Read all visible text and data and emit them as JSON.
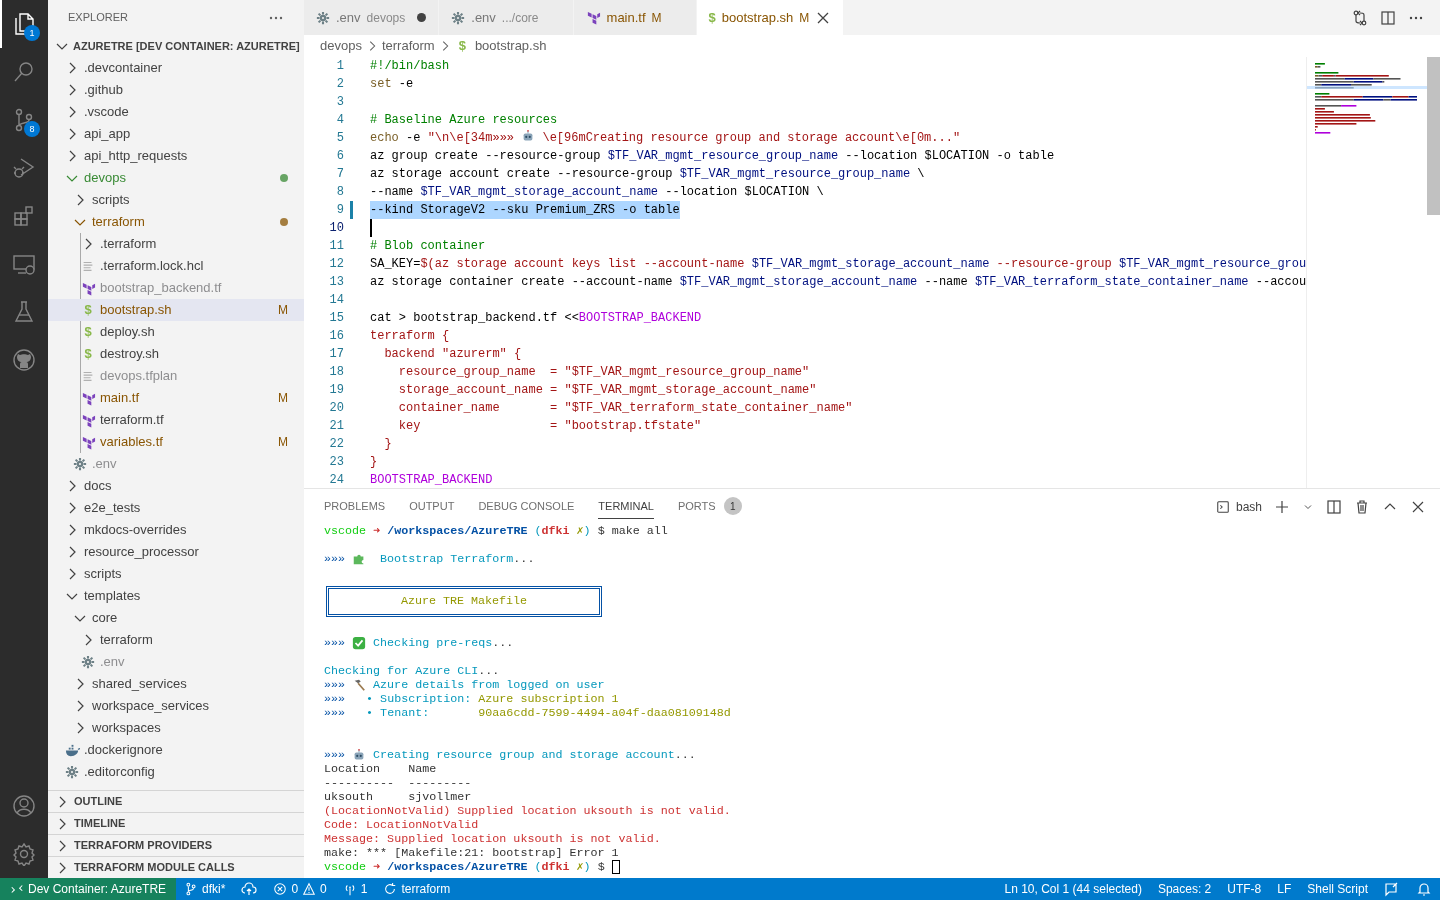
{
  "activity_bar": {
    "items": [
      {
        "kind": "files",
        "selected": true,
        "badge": "1"
      },
      {
        "kind": "search",
        "selected": false
      },
      {
        "kind": "source-control",
        "selected": false,
        "badge": "8"
      },
      {
        "kind": "run-debug",
        "selected": false
      },
      {
        "kind": "extensions",
        "selected": false
      },
      {
        "kind": "remote",
        "selected": false
      },
      {
        "kind": "testing",
        "selected": false
      },
      {
        "kind": "github",
        "selected": false
      }
    ],
    "bottom": [
      {
        "kind": "account"
      },
      {
        "kind": "settings"
      }
    ]
  },
  "sidebar": {
    "title": "EXPLORER",
    "root": {
      "label": "AZURETRE [DEV CONTAINER: AZURETRE]",
      "expanded": true
    },
    "items": [
      {
        "label": ".devcontainer",
        "kind": "folder",
        "expanded": false,
        "selected": false
      },
      {
        "label": ".github",
        "kind": "folder",
        "expanded": false,
        "selected": false
      },
      {
        "label": ".vscode",
        "kind": "folder",
        "expanded": false,
        "selected": false
      },
      {
        "label": "api_app",
        "kind": "folder",
        "expanded": false,
        "selected": false
      },
      {
        "label": "api_http_requests",
        "kind": "folder",
        "expanded": false,
        "selected": false
      },
      {
        "label": "devops",
        "kind": "folder",
        "expanded": true,
        "selected": false,
        "color": "#388a34",
        "dot": true,
        "children": [
          {
            "label": "scripts",
            "kind": "folder",
            "expanded": false,
            "selected": false
          },
          {
            "label": "terraform",
            "kind": "folder",
            "expanded": true,
            "selected": false,
            "color": "#895503",
            "dot": true,
            "children": [
              {
                "label": ".terraform",
                "kind": "folder",
                "expanded": false,
                "selected": false
              },
              {
                "label": ".terraform.lock.hcl",
                "kind": "text",
                "selected": false
              },
              {
                "label": "bootstrap_backend.tf",
                "kind": "terraform",
                "selected": false,
                "color": "#8e8e90"
              },
              {
                "label": "bootstrap.sh",
                "kind": "shell",
                "glyph": "$",
                "selected": true,
                "color": "#895503",
                "badge": "M"
              },
              {
                "label": "deploy.sh",
                "kind": "shell",
                "glyph": "$",
                "selected": false
              },
              {
                "label": "destroy.sh",
                "kind": "shell",
                "glyph": "$",
                "selected": false
              },
              {
                "label": "devops.tfplan",
                "kind": "text",
                "selected": false,
                "color": "#8e8e90"
              },
              {
                "label": "main.tf",
                "kind": "terraform",
                "selected": false,
                "color": "#895503",
                "badge": "M"
              },
              {
                "label": "terraform.tf",
                "kind": "terraform",
                "selected": false
              },
              {
                "label": "variables.tf",
                "kind": "terraform",
                "selected": false,
                "color": "#895503",
                "badge": "M"
              }
            ]
          },
          {
            "label": ".env",
            "kind": "config",
            "selected": false,
            "color": "#8e8e90"
          }
        ]
      },
      {
        "label": "docs",
        "kind": "folder",
        "expanded": false,
        "selected": false
      },
      {
        "label": "e2e_tests",
        "kind": "folder",
        "expanded": false,
        "selected": false
      },
      {
        "label": "mkdocs-overrides",
        "kind": "folder",
        "expanded": false,
        "selected": false
      },
      {
        "label": "resource_processor",
        "kind": "folder",
        "expanded": false,
        "selected": false
      },
      {
        "label": "scripts",
        "kind": "folder",
        "expanded": false,
        "selected": false
      },
      {
        "label": "templates",
        "kind": "folder",
        "expanded": true,
        "selected": false,
        "children": [
          {
            "label": "core",
            "kind": "folder",
            "expanded": true,
            "selected": false,
            "children": [
              {
                "label": "terraform",
                "kind": "folder",
                "expanded": false,
                "selected": false
              },
              {
                "label": ".env",
                "kind": "config",
                "selected": false,
                "color": "#8e8e90"
              }
            ]
          },
          {
            "label": "shared_services",
            "kind": "folder",
            "expanded": false,
            "selected": false
          },
          {
            "label": "workspace_services",
            "kind": "folder",
            "expanded": false,
            "selected": false
          },
          {
            "label": "workspaces",
            "kind": "folder",
            "expanded": false,
            "selected": false
          }
        ]
      },
      {
        "label": ".dockerignore",
        "kind": "docker",
        "selected": false
      },
      {
        "label": ".editorconfig",
        "kind": "config",
        "selected": false
      }
    ],
    "sections": [
      {
        "label": "OUTLINE",
        "expanded": false
      },
      {
        "label": "TIMELINE",
        "expanded": false
      },
      {
        "label": "TERRAFORM PROVIDERS",
        "expanded": false
      },
      {
        "label": "TERRAFORM MODULE CALLS",
        "expanded": false
      }
    ]
  },
  "editor": {
    "tabs": [
      {
        "kind": "config",
        "label": ".env",
        "description": "devops",
        "dirty": true,
        "selected": false
      },
      {
        "kind": "config",
        "label": ".env",
        "description": ".../core",
        "dirty": false,
        "selected": false
      },
      {
        "kind": "terraform",
        "label": "main.tf",
        "badge": "M",
        "color": "#895503",
        "dirty": false,
        "selected": false
      },
      {
        "kind": "shell",
        "glyph": "$",
        "label": "bootstrap.sh",
        "badge": "M",
        "color": "#895503",
        "dirty": false,
        "selected": true
      }
    ],
    "breadcrumb": [
      {
        "label": "devops"
      },
      {
        "label": "terraform"
      },
      {
        "label": "bootstrap.sh",
        "kind": "shell",
        "glyph": "$"
      }
    ],
    "lines": [
      {
        "number": "1",
        "selected": false,
        "cursor": false,
        "segments": [
          {
            "kind": "comment",
            "text": "#!/bin/bash"
          }
        ]
      },
      {
        "number": "2",
        "selected": false,
        "cursor": false,
        "segments": [
          {
            "kind": "keyword",
            "text": "set"
          },
          {
            "kind": "plain",
            "text": " -e"
          }
        ]
      },
      {
        "number": "3",
        "selected": false,
        "cursor": false
      },
      {
        "number": "4",
        "selected": false,
        "cursor": false,
        "segments": [
          {
            "kind": "comment",
            "text": "# Baseline Azure resources"
          }
        ]
      },
      {
        "number": "5",
        "selected": false,
        "cursor": false,
        "segments": [
          {
            "kind": "keyword",
            "text": "echo"
          },
          {
            "kind": "plain",
            "text": " -e "
          },
          {
            "kind": "string",
            "text": "\"\\n\\e[34m»»» "
          },
          {
            "kind": "robot"
          },
          {
            "kind": "string",
            "text": " \\e[96mCreating resource group and storage account\\e[0m...\""
          }
        ]
      },
      {
        "number": "6",
        "selected": false,
        "cursor": false,
        "segments": [
          {
            "kind": "plain",
            "text": "az group create --resource-group "
          },
          {
            "kind": "variable",
            "text": "$TF_VAR_mgmt_resource_group_name"
          },
          {
            "kind": "plain",
            "text": " --location $LOCATION -o table"
          }
        ]
      },
      {
        "number": "7",
        "selected": false,
        "cursor": false,
        "segments": [
          {
            "kind": "plain",
            "text": "az storage account create --resource-group "
          },
          {
            "kind": "variable",
            "text": "$TF_VAR_mgmt_resource_group_name"
          },
          {
            "kind": "plain",
            "text": " \\"
          }
        ]
      },
      {
        "number": "8",
        "selected": false,
        "cursor": false,
        "segments": [
          {
            "kind": "plain",
            "text": "--name "
          },
          {
            "kind": "variable",
            "text": "$TF_VAR_mgmt_storage_account_name"
          },
          {
            "kind": "plain",
            "text": " --location $LOCATION \\"
          }
        ]
      },
      {
        "number": "9",
        "selected": true,
        "cursor": false,
        "changed": true,
        "segments": [
          {
            "kind": "plain",
            "text": "--kind StorageV2 --sku Premium_ZRS -o table"
          }
        ]
      },
      {
        "number": "10",
        "selected": false,
        "cursor": true
      },
      {
        "number": "11",
        "selected": false,
        "cursor": false,
        "segments": [
          {
            "kind": "comment",
            "text": "# Blob container"
          }
        ]
      },
      {
        "number": "12",
        "selected": false,
        "cursor": false,
        "segments": [
          {
            "kind": "plain",
            "text": "SA_KEY="
          },
          {
            "kind": "string",
            "text": "$(az storage account keys list --account-name "
          },
          {
            "kind": "variable",
            "text": "$TF_VAR_mgmt_storage_account_name"
          },
          {
            "kind": "string",
            "text": " --resource-group "
          },
          {
            "kind": "variable",
            "text": "$TF_VAR_mgmt_resource_grou"
          }
        ]
      },
      {
        "number": "13",
        "selected": false,
        "cursor": false,
        "segments": [
          {
            "kind": "plain",
            "text": "az storage container create --account-name "
          },
          {
            "kind": "variable",
            "text": "$TF_VAR_mgmt_storage_account_name"
          },
          {
            "kind": "plain",
            "text": " --name "
          },
          {
            "kind": "variable",
            "text": "$TF_VAR_terraform_state_container_name"
          },
          {
            "kind": "plain",
            "text": " --accou"
          }
        ]
      },
      {
        "number": "14",
        "selected": false,
        "cursor": false
      },
      {
        "number": "15",
        "selected": false,
        "cursor": false,
        "segments": [
          {
            "kind": "plain",
            "text": "cat > bootstrap_backend.tf <<"
          },
          {
            "kind": "heredoc",
            "text": "BOOTSTRAP_BACKEND"
          }
        ]
      },
      {
        "number": "16",
        "selected": false,
        "cursor": false,
        "segments": [
          {
            "kind": "string",
            "text": "terraform {"
          }
        ]
      },
      {
        "number": "17",
        "selected": false,
        "cursor": false,
        "segments": [
          {
            "kind": "string",
            "text": "  backend \"azurerm\" {"
          }
        ]
      },
      {
        "number": "18",
        "selected": false,
        "cursor": false,
        "segments": [
          {
            "kind": "string",
            "text": "    resource_group_name  = \"$TF_VAR_mgmt_resource_group_name\""
          }
        ]
      },
      {
        "number": "19",
        "selected": false,
        "cursor": false,
        "segments": [
          {
            "kind": "string",
            "text": "    storage_account_name = \"$TF_VAR_mgmt_storage_account_name\""
          }
        ]
      },
      {
        "number": "20",
        "selected": false,
        "cursor": false,
        "segments": [
          {
            "kind": "string",
            "text": "    container_name       = \"$TF_VAR_terraform_state_container_name\""
          }
        ]
      },
      {
        "number": "21",
        "selected": false,
        "cursor": false,
        "segments": [
          {
            "kind": "string",
            "text": "    key                  = \"bootstrap.tfstate\""
          }
        ]
      },
      {
        "number": "22",
        "selected": false,
        "cursor": false,
        "segments": [
          {
            "kind": "string",
            "text": "  }"
          }
        ]
      },
      {
        "number": "23",
        "selected": false,
        "cursor": false,
        "segments": [
          {
            "kind": "string",
            "text": "}"
          }
        ]
      },
      {
        "number": "24",
        "selected": false,
        "cursor": false,
        "segments": [
          {
            "kind": "heredoc",
            "text": "BOOTSTRAP_BACKEND"
          }
        ]
      }
    ]
  },
  "panel": {
    "tabs": [
      {
        "label": "PROBLEMS",
        "selected": false
      },
      {
        "label": "OUTPUT",
        "selected": false
      },
      {
        "label": "DEBUG CONSOLE",
        "selected": false
      },
      {
        "label": "TERMINAL",
        "selected": true
      },
      {
        "label": "PORTS",
        "badge": "1",
        "selected": false
      }
    ],
    "terminal_name": "bash",
    "lines": [
      {
        "kind": "text",
        "segments": [
          {
            "kind": "user",
            "text": "vscode"
          },
          {
            "kind": "arrow",
            "text": " ➜ "
          },
          {
            "kind": "path",
            "text": "/workspaces/AzureTRE"
          },
          {
            "kind": "paren",
            "text": " ("
          },
          {
            "kind": "branch",
            "text": "dfki"
          },
          {
            "kind": "dirty",
            "text": " ✗"
          },
          {
            "kind": "paren",
            "text": ")"
          },
          {
            "kind": "plain",
            "text": " $ make all"
          }
        ]
      },
      {
        "kind": "blank"
      },
      {
        "kind": "text",
        "segments": [
          {
            "kind": "marker",
            "text": "»»» "
          },
          {
            "kind": "puzzle"
          },
          {
            "kind": "info",
            "text": "  Bootstrap Terraform"
          },
          {
            "kind": "plain",
            "text": "..."
          }
        ]
      },
      {
        "kind": "blank"
      },
      {
        "kind": "box",
        "text": "Azure TRE Makefile"
      },
      {
        "kind": "blank"
      },
      {
        "kind": "text",
        "segments": [
          {
            "kind": "marker",
            "text": "»»» "
          },
          {
            "kind": "check"
          },
          {
            "kind": "info",
            "text": " Checking pre-reqs"
          },
          {
            "kind": "plain",
            "text": "..."
          }
        ]
      },
      {
        "kind": "blank"
      },
      {
        "kind": "text",
        "segments": [
          {
            "kind": "info",
            "text": "Checking for Azure CLI"
          },
          {
            "kind": "plain",
            "text": "..."
          }
        ]
      },
      {
        "kind": "text",
        "segments": [
          {
            "kind": "marker",
            "text": "»»» "
          },
          {
            "kind": "hammer"
          },
          {
            "kind": "info",
            "text": " Azure details from logged on user"
          }
        ]
      },
      {
        "kind": "text",
        "segments": [
          {
            "kind": "marker",
            "text": "»»»"
          },
          {
            "kind": "info",
            "text": "   • Subscription: "
          },
          {
            "kind": "value",
            "text": "Azure subscription 1"
          }
        ]
      },
      {
        "kind": "text",
        "segments": [
          {
            "kind": "marker",
            "text": "»»»"
          },
          {
            "kind": "info",
            "text": "   • Tenant:       "
          },
          {
            "kind": "value",
            "text": "90aa6cdd-7599-4494-a04f-daa08109148d"
          }
        ]
      },
      {
        "kind": "blank"
      },
      {
        "kind": "blank"
      },
      {
        "kind": "text",
        "segments": [
          {
            "kind": "marker",
            "text": "»»» "
          },
          {
            "kind": "robot"
          },
          {
            "kind": "info",
            "text": " Creating resource group and storage account"
          },
          {
            "kind": "plain",
            "text": "..."
          }
        ]
      },
      {
        "kind": "text",
        "segments": [
          {
            "kind": "plain",
            "text": "Location    Name"
          }
        ]
      },
      {
        "kind": "text",
        "segments": [
          {
            "kind": "plain",
            "text": "----------  ---------"
          }
        ]
      },
      {
        "kind": "text",
        "segments": [
          {
            "kind": "plain",
            "text": "uksouth     sjvollmer"
          }
        ]
      },
      {
        "kind": "text",
        "segments": [
          {
            "kind": "error",
            "text": "(LocationNotValid) Supplied location uksouth is not valid."
          }
        ]
      },
      {
        "kind": "text",
        "segments": [
          {
            "kind": "error",
            "text": "Code: LocationNotValid"
          }
        ]
      },
      {
        "kind": "text",
        "segments": [
          {
            "kind": "error",
            "text": "Message: Supplied location uksouth is not valid."
          }
        ]
      },
      {
        "kind": "text",
        "segments": [
          {
            "kind": "plain",
            "text": "make: *** [Makefile:21: bootstrap] Error 1"
          }
        ]
      },
      {
        "kind": "text",
        "segments": [
          {
            "kind": "user",
            "text": "vscode"
          },
          {
            "kind": "arrow",
            "text": " ➜ "
          },
          {
            "kind": "path",
            "text": "/workspaces/AzureTRE"
          },
          {
            "kind": "paren",
            "text": " ("
          },
          {
            "kind": "branch",
            "text": "dfki"
          },
          {
            "kind": "dirty",
            "text": " ✗"
          },
          {
            "kind": "paren",
            "text": ")"
          },
          {
            "kind": "plain",
            "text": " $ "
          },
          {
            "kind": "cursor"
          }
        ]
      }
    ]
  },
  "status_bar": {
    "left": [
      {
        "kind": "remote",
        "text": "Dev Container: AzureTRE"
      },
      {
        "kind": "branch",
        "text": "dfki*"
      },
      {
        "kind": "sync"
      },
      {
        "kind": "problems",
        "errors": "0",
        "warnings": "0"
      },
      {
        "kind": "ports",
        "text": "1"
      },
      {
        "kind": "refresh",
        "text": "terraform"
      }
    ],
    "right": [
      {
        "kind": "text",
        "text": "Ln 10, Col 1 (44 selected)"
      },
      {
        "kind": "text",
        "text": "Spaces: 2"
      },
      {
        "kind": "text",
        "text": "UTF-8"
      },
      {
        "kind": "text",
        "text": "LF"
      },
      {
        "kind": "text",
        "text": "Shell Script"
      },
      {
        "kind": "feedback"
      },
      {
        "kind": "bell"
      }
    ]
  }
}
